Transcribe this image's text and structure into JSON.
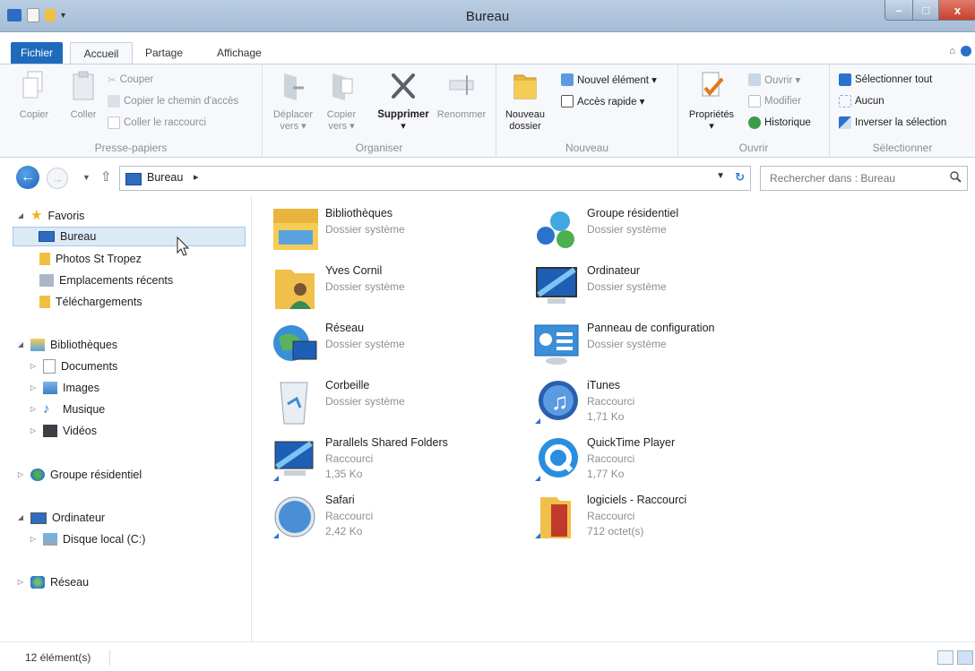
{
  "window": {
    "title": "Bureau"
  },
  "tabs": {
    "file": "Fichier",
    "home": "Accueil",
    "share": "Partage",
    "view": "Affichage"
  },
  "ribbon": {
    "clipboard": {
      "label": "Presse-papiers",
      "copy": "Copier",
      "paste": "Coller",
      "cut": "Couper",
      "copy_path": "Copier le chemin d'accès",
      "paste_shortcut": "Coller le raccourci"
    },
    "organize": {
      "label": "Organiser",
      "move": "Déplacer",
      "move_sub": "vers ▾",
      "copyto": "Copier",
      "copyto_sub": "vers ▾",
      "delete": "Supprimer",
      "delete_sub": "▾",
      "rename": "Renommer"
    },
    "new": {
      "label": "Nouveau",
      "new_folder": "Nouveau",
      "new_folder_sub": "dossier",
      "new_item": "Nouvel élément ▾",
      "quick_access": "Accès rapide ▾"
    },
    "open": {
      "label": "Ouvrir",
      "properties": "Propriétés",
      "properties_sub": "▾",
      "open": "Ouvrir ▾",
      "edit": "Modifier",
      "history": "Historique"
    },
    "select": {
      "label": "Sélectionner",
      "select_all": "Sélectionner tout",
      "select_none": "Aucun",
      "invert": "Inverser la sélection"
    }
  },
  "address": {
    "location": "Bureau",
    "breadcrumb_arrow": "▸",
    "search_placeholder": "Rechercher dans : Bureau"
  },
  "navpane": {
    "favorites": "Favoris",
    "fav_items": [
      "Bureau",
      "Photos St Tropez",
      "Emplacements récents",
      "Téléchargements"
    ],
    "libraries": "Bibliothèques",
    "lib_items": [
      "Documents",
      "Images",
      "Musique",
      "Vidéos"
    ],
    "homegroup": "Groupe résidentiel",
    "computer": "Ordinateur",
    "computer_items": [
      "Disque local (C:)"
    ],
    "network": "Réseau"
  },
  "items": [
    {
      "name": "Bibliothèques",
      "type": "Dossier système",
      "size": ""
    },
    {
      "name": "Groupe résidentiel",
      "type": "Dossier système",
      "size": ""
    },
    {
      "name": "Yves Cornil",
      "type": "Dossier système",
      "size": ""
    },
    {
      "name": "Ordinateur",
      "type": "Dossier système",
      "size": ""
    },
    {
      "name": "Réseau",
      "type": "Dossier système",
      "size": ""
    },
    {
      "name": "Panneau de configuration",
      "type": "Dossier système",
      "size": ""
    },
    {
      "name": "Corbeille",
      "type": "Dossier système",
      "size": ""
    },
    {
      "name": "iTunes",
      "type": "Raccourci",
      "size": "1,71 Ko"
    },
    {
      "name": "Parallels Shared Folders",
      "type": "Raccourci",
      "size": "1,35 Ko"
    },
    {
      "name": "QuickTime Player",
      "type": "Raccourci",
      "size": "1,77 Ko"
    },
    {
      "name": "Safari",
      "type": "Raccourci",
      "size": "2,42 Ko"
    },
    {
      "name": "logiciels - Raccourci",
      "type": "Raccourci",
      "size": "712 octet(s)"
    }
  ],
  "status": {
    "count": "12 élément(s)"
  },
  "colors": {
    "accent": "#1e6bbd",
    "selection": "#dce9f7",
    "muted_text": "#8a8f96"
  }
}
